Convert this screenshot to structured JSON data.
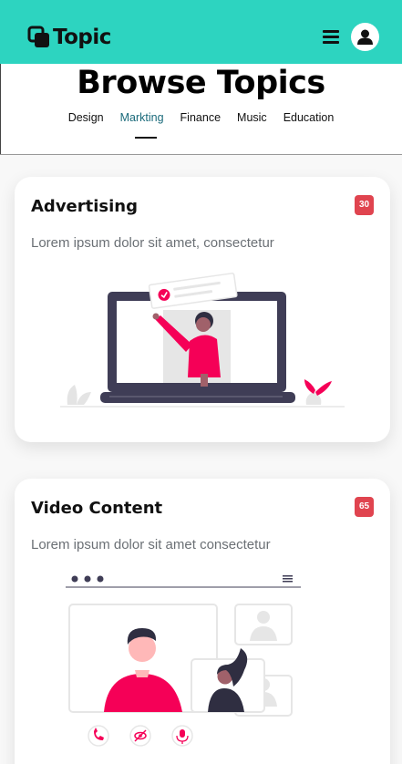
{
  "header": {
    "logo_text": "Topic"
  },
  "page": {
    "title": "Browse Topics"
  },
  "tabs": [
    {
      "label": "Design",
      "active": false
    },
    {
      "label": "Markting",
      "active": true
    },
    {
      "label": "Finance",
      "active": false
    },
    {
      "label": "Music",
      "active": false
    },
    {
      "label": "Education",
      "active": false
    }
  ],
  "cards": [
    {
      "title": "Advertising",
      "badge": "30",
      "description": "Lorem ipsum dolor sit amet, consectetur"
    },
    {
      "title": "Video Content",
      "badge": "65",
      "description": "Lorem ipsum dolor sit amet consectetur"
    }
  ],
  "colors": {
    "header_bg": "#2dd4c0",
    "badge": "#e0444f",
    "accent": "#f50057",
    "laptop": "#3f3d56"
  }
}
